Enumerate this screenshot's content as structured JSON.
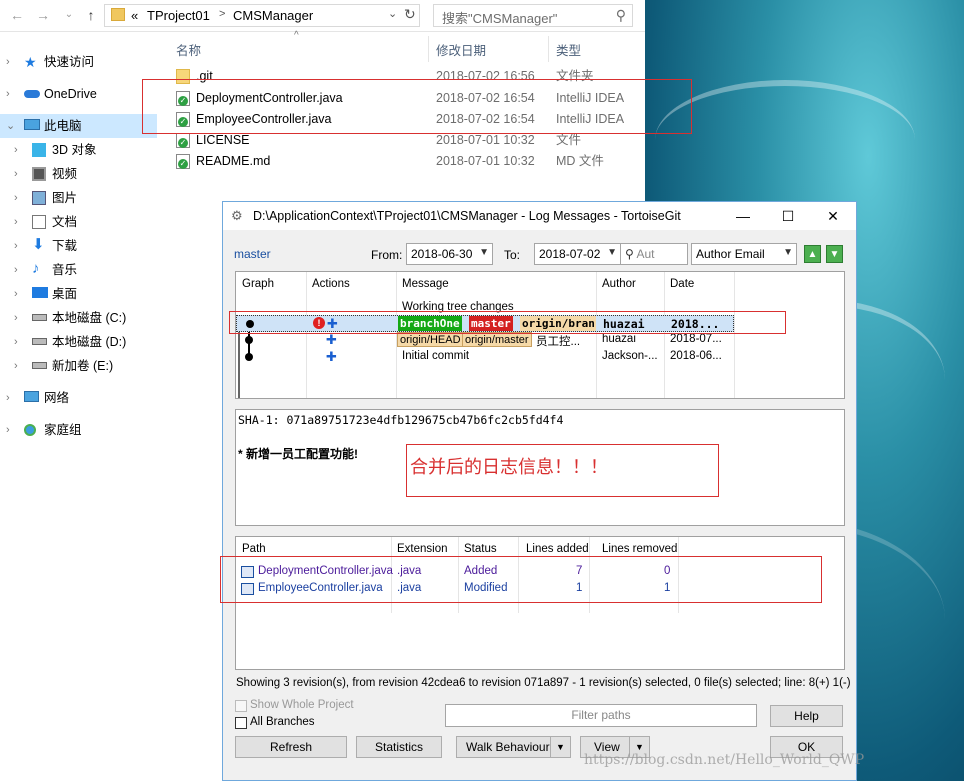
{
  "explorer": {
    "address": {
      "prefix": "«",
      "parts": [
        "TProject01",
        "CMSManager"
      ],
      "sep": ">"
    },
    "search_placeholder": "搜索\"CMSManager\"",
    "nav": [
      {
        "label": "快速访问",
        "icon": "star-icon"
      },
      {
        "label": "OneDrive",
        "icon": "cloud-icon"
      },
      {
        "label": "此电脑",
        "icon": "computer-icon"
      },
      {
        "label": "3D 对象",
        "icon": "cube-icon"
      },
      {
        "label": "视频",
        "icon": "video-icon"
      },
      {
        "label": "图片",
        "icon": "picture-icon"
      },
      {
        "label": "文档",
        "icon": "document-icon"
      },
      {
        "label": "下载",
        "icon": "download-icon"
      },
      {
        "label": "音乐",
        "icon": "music-icon"
      },
      {
        "label": "桌面",
        "icon": "desktop-icon"
      },
      {
        "label": "本地磁盘 (C:)",
        "icon": "drive-icon"
      },
      {
        "label": "本地磁盘 (D:)",
        "icon": "drive-icon"
      },
      {
        "label": "新加卷 (E:)",
        "icon": "drive-icon"
      },
      {
        "label": "网络",
        "icon": "network-icon"
      },
      {
        "label": "家庭组",
        "icon": "homegroup-icon"
      }
    ],
    "columns": {
      "name": "名称",
      "date": "修改日期",
      "type": "类型"
    },
    "files": [
      {
        "name": ".git",
        "date": "2018-07-02 16:56",
        "type": "文件夹",
        "icon": "folder-icon"
      },
      {
        "name": "DeploymentController.java",
        "date": "2018-07-02 16:54",
        "type": "IntelliJ IDEA",
        "icon": "git-check-icon"
      },
      {
        "name": "EmployeeController.java",
        "date": "2018-07-02 16:54",
        "type": "IntelliJ IDEA",
        "icon": "git-check-icon"
      },
      {
        "name": "LICENSE",
        "date": "2018-07-01 10:32",
        "type": "文件",
        "icon": "git-check-icon"
      },
      {
        "name": "README.md",
        "date": "2018-07-01 10:32",
        "type": "MD 文件",
        "icon": "git-check-icon"
      }
    ]
  },
  "tortoise": {
    "title": "D:\\ApplicationContext\\TProject01\\CMSManager - Log Messages - TortoiseGit",
    "branch": "master",
    "from_label": "From:",
    "from_value": "2018-06-30",
    "to_label": "To:",
    "to_value": "2018-07-02",
    "search_placeholder": "Aut",
    "filter_field": "Author Email",
    "log_headers": {
      "graph": "Graph",
      "actions": "Actions",
      "message": "Message",
      "author": "Author",
      "date": "Date"
    },
    "log_rows": [
      {
        "message": "Working tree changes",
        "author": "",
        "date": ""
      },
      {
        "tags": [
          "branchOne",
          "master",
          "origin/bran"
        ],
        "message": "",
        "author": "huazai",
        "date": "2018..."
      },
      {
        "tags": [
          "origin/HEAD",
          "origin/master"
        ],
        "message": "员工控...",
        "author": "huazai",
        "date": "2018-07..."
      },
      {
        "message": "Initial commit",
        "author": "Jackson-...",
        "date": "2018-06..."
      }
    ],
    "sha": "SHA-1: 071a89751723e4dfb129675cb47b6fc2cb5fd4f4",
    "commit_message": "* 新增一员工配置功能!",
    "annotation": "合并后的日志信息！！！",
    "file_headers": {
      "path": "Path",
      "ext": "Extension",
      "status": "Status",
      "added": "Lines added",
      "removed": "Lines removed"
    },
    "files": [
      {
        "path": "DeploymentController.java",
        "ext": ".java",
        "status": "Added",
        "added": "7",
        "removed": "0"
      },
      {
        "path": "EmployeeController.java",
        "ext": ".java",
        "status": "Modified",
        "added": "1",
        "removed": "1"
      }
    ],
    "status_line": "Showing 3 revision(s), from revision 42cdea6 to revision 071a897 - 1 revision(s) selected, 0 file(s) selected; line: 8(+) 1(-)",
    "show_whole_project": "Show Whole Project",
    "all_branches": "All Branches",
    "filter_placeholder": "Filter paths",
    "buttons": {
      "help": "Help",
      "refresh": "Refresh",
      "statistics": "Statistics",
      "walk": "Walk Behaviour",
      "view": "View",
      "ok": "OK"
    }
  },
  "watermark": "https://blog.csdn.net/Hello_World_QWP"
}
